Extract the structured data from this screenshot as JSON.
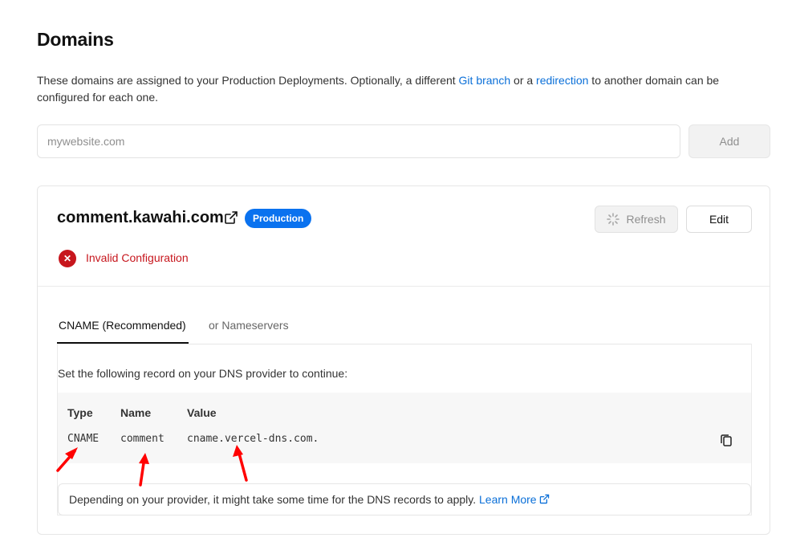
{
  "page": {
    "title": "Domains",
    "description_prefix": "These domains are assigned to your Production Deployments. Optionally, a different ",
    "git_branch_link": "Git branch",
    "description_middle": " or a ",
    "redirection_link": "redirection",
    "description_suffix": " to another domain can be configured for each one."
  },
  "add_domain": {
    "placeholder": "mywebsite.com",
    "button_label": "Add"
  },
  "domain_card": {
    "domain": "comment.kawahi.com",
    "badge": "Production",
    "refresh_label": "Refresh",
    "edit_label": "Edit",
    "status_text": "Invalid Configuration",
    "status_color": "#c7161d",
    "tabs": [
      {
        "label": "CNAME (Recommended)",
        "active": true
      },
      {
        "label": "or Nameservers",
        "active": false
      }
    ],
    "instructions": "Set the following record on your DNS provider to continue:",
    "record": {
      "headers": {
        "type": "Type",
        "name": "Name",
        "value": "Value"
      },
      "type": "CNAME",
      "name": "comment",
      "value": "cname.vercel-dns.com."
    },
    "notice_text": "Depending on your provider, it might take some time for the DNS records to apply. ",
    "learn_more": "Learn More"
  },
  "icons": {
    "external_link": "external-link-icon",
    "spinner": "spinner-icon",
    "error": "error-x-icon",
    "copy": "copy-icon",
    "annotation_arrow": "red-arrow-annotation"
  },
  "colors": {
    "link": "#0a6fd8",
    "badge": "#0a72ef",
    "error": "#c7161d",
    "arrow": "#ff0000"
  }
}
